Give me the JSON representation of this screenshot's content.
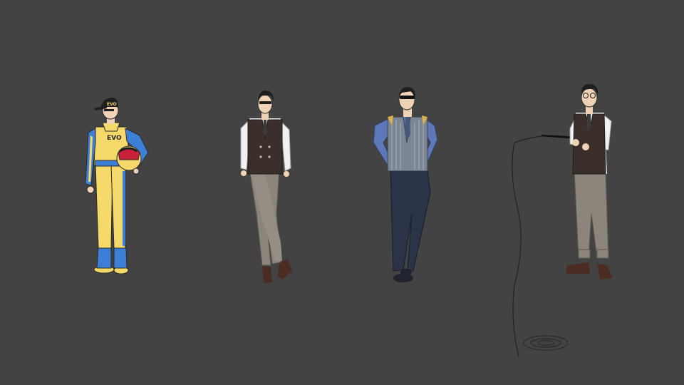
{
  "canvas": {
    "background": "#434343"
  },
  "characters": [
    {
      "role": "racing-driver",
      "outfit": "racing-suit",
      "cap_text": "EVO",
      "suit_text": "EVO",
      "colors": {
        "suit": "#f5d96a",
        "trim": "#3d7fd6",
        "cap": "#1e1e1e",
        "helmet": "#f5d96a",
        "visor": "#c9213a"
      }
    },
    {
      "role": "gentleman-crossed-legs",
      "outfit": "double-breasted-vest",
      "colors": {
        "vest": "#3a2f2a",
        "shirt": "#f2f2f2",
        "trousers": "#8b857c",
        "shoes": "#4a2c22"
      }
    },
    {
      "role": "man-in-sunglasses",
      "outfit": "pinstripe-vest",
      "colors": {
        "vest": "#7c8594",
        "shirt": "#5d77b8",
        "trousers": "#2b3347",
        "shoes": "#1f2430"
      }
    },
    {
      "role": "fisherman",
      "outfit": "vest-with-fishing-rod",
      "colors": {
        "vest": "#3a2f2a",
        "shirt": "#f2f2f2",
        "trousers": "#8b857c",
        "shoes": "#4a2c22",
        "line": "#222222"
      }
    }
  ]
}
